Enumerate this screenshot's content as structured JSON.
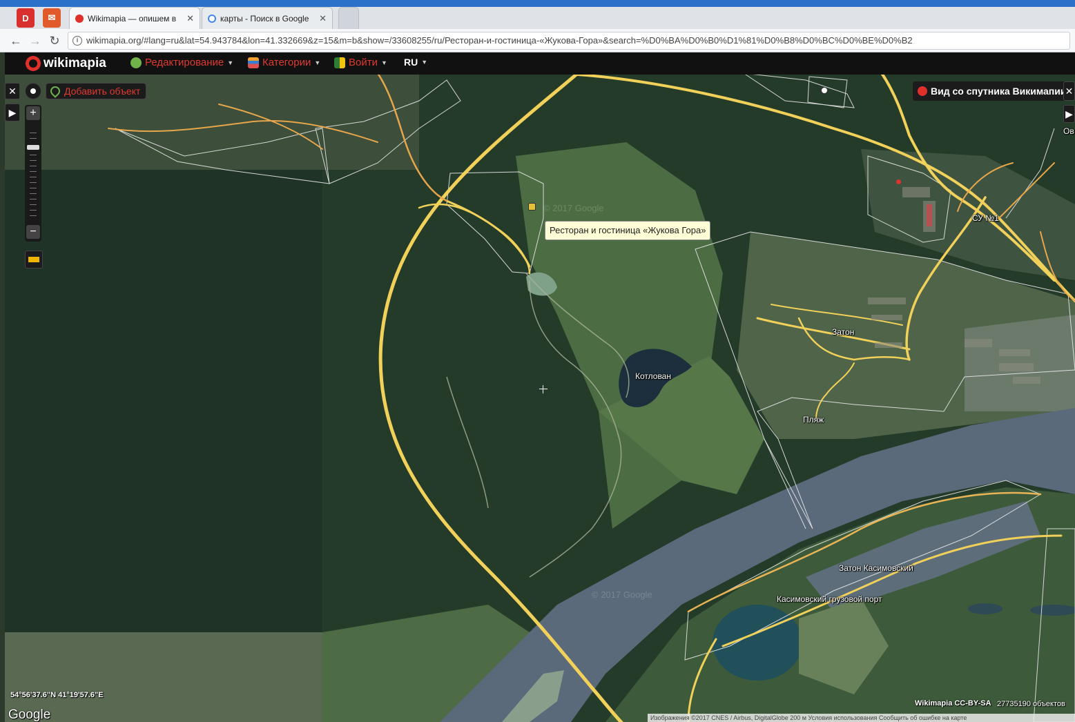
{
  "browser": {
    "pinned_tabs": [
      {
        "label": "D",
        "color": "#d9302f"
      },
      {
        "label": "✉",
        "color": "#e05a2b"
      }
    ],
    "tabs": [
      {
        "title": "Wikimapia — опишем в",
        "close": "✕",
        "icon": "wikimapia-icon",
        "active": true
      },
      {
        "title": "карты - Поиск в Google",
        "close": "✕",
        "icon": "google-icon",
        "active": false
      }
    ],
    "url": "wikimapia.org/#lang=ru&lat=54.943784&lon=41.332669&z=15&m=b&show=/33608255/ru/Ресторан-и-гостиница-«Жукова-Гора»&search=%D0%BA%D0%B0%D1%81%D0%B8%D0%BC%D0%BE%D0%B2"
  },
  "toolbar": {
    "logo": "wikimapia",
    "edit_label": "Редактирование",
    "categories_label": "Категории",
    "login_label": "Войти",
    "lang_label": "RU"
  },
  "controls": {
    "close_symbol": "✕",
    "add_object_label": "Добавить объект",
    "satellite_view_label": "Вид со спутника Викимапии",
    "partial_right_label": "Ов"
  },
  "map": {
    "tooltip": "Ресторан и гостиница «Жукова Гора»",
    "labels": {
      "kotlovan": "Котлован",
      "zaton": "Затон",
      "plyazh": "Пляж",
      "su1": "СУ №1",
      "zaton_kasimovsky": "Затон Касимовский",
      "cargo_port": "Касимовский грузовой порт"
    },
    "watermark": "© 2017 Google",
    "colors": {
      "road": "#f1d15a",
      "forest": "#233a28",
      "field": "#4f6b45",
      "river": "#586777",
      "boundary": "#e8e8e8"
    }
  },
  "footer": {
    "coords": "54°56'37.6\"N 41°19'57.6\"E",
    "google_logo": "Google",
    "license": "Wikimapia CC-BY-SA",
    "objects_count": "27735190 объектов",
    "copyright": "Изображения ©2017 CNES / Airbus, DigitalGlobe   200 м      Условия использования   Сообщить об ошибке на карте"
  }
}
